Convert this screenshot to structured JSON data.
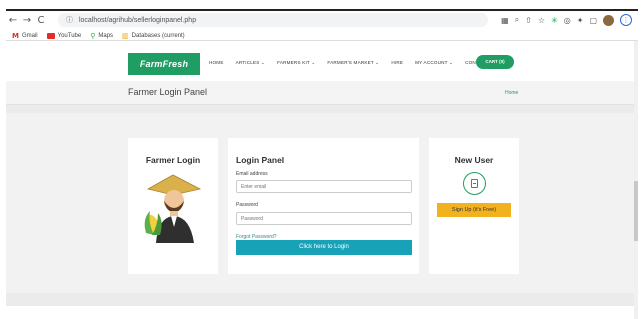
{
  "browser": {
    "url": "localhost/agrihub/sellerloginpanel.php",
    "bookmarks": [
      {
        "icon": "gmail-icon",
        "label": "Gmail"
      },
      {
        "icon": "youtube-icon",
        "label": "YouTube"
      },
      {
        "icon": "maps-icon",
        "label": "Maps"
      },
      {
        "icon": "database-icon",
        "label": "Databases (current)"
      }
    ]
  },
  "header": {
    "logo": "FarmFresh",
    "menu": [
      "Home",
      "Articles ⌄",
      "Farmers Kit ⌄",
      "Farmer's Market ⌄",
      "Hire",
      "My Account ⌄",
      "Contact"
    ],
    "cart": "CART (0)"
  },
  "titlebar": {
    "title": "Farmer Login Panel",
    "breadcrumb": "Home"
  },
  "farmer_card": {
    "title": "Farmer Login"
  },
  "login_card": {
    "title": "Login Panel",
    "email_label": "Email address",
    "email_placeholder": "Enter email",
    "password_label": "Password",
    "password_placeholder": "Password",
    "forgot": "Forgot Password?",
    "submit": "Click here to Login"
  },
  "new_user_card": {
    "title": "New User",
    "signup": "Sign Up (it's Free)"
  },
  "colors": {
    "brand_green": "#1f9d62",
    "login_button": "#17a2b8",
    "signup_button": "#f2b11e"
  }
}
